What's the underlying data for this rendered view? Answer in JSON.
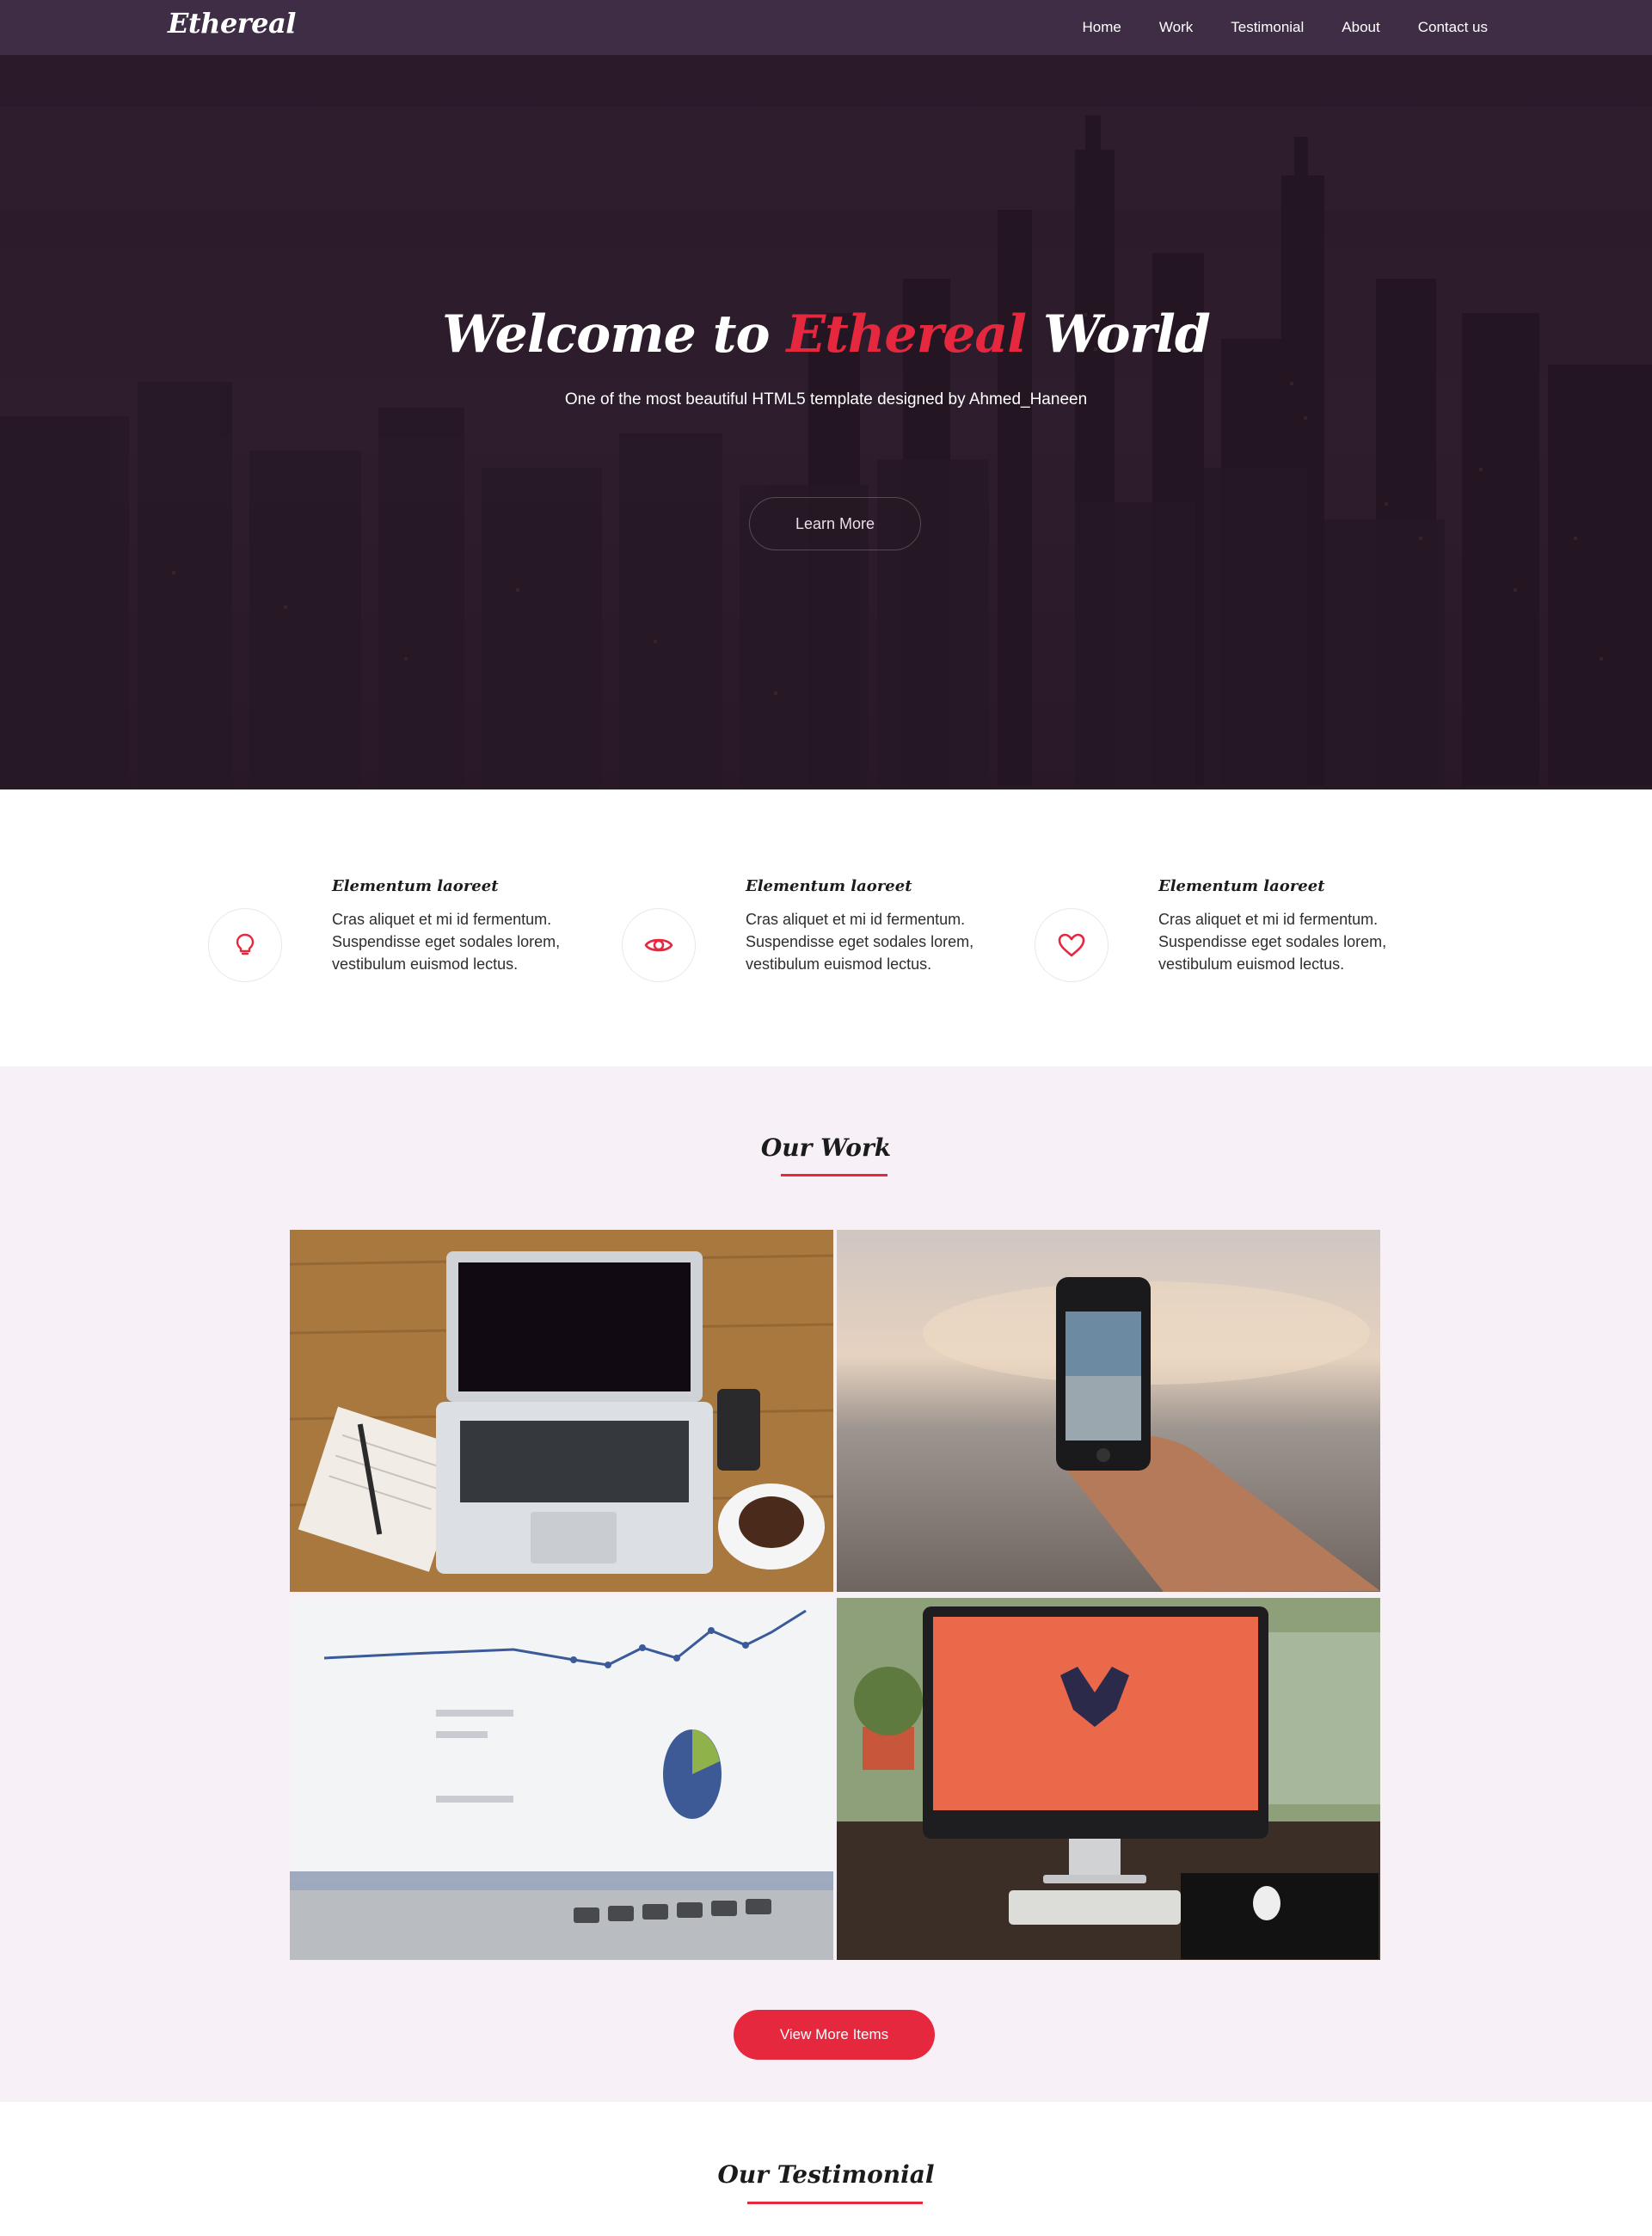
{
  "nav": {
    "brand": "Ethereal",
    "items": [
      {
        "label": "Home"
      },
      {
        "label": "Work"
      },
      {
        "label": "Testimonial"
      },
      {
        "label": "About"
      },
      {
        "label": "Contact us"
      }
    ]
  },
  "hero": {
    "title_pre": "Welcome to ",
    "title_accent": "Ethereal",
    "title_post": " World",
    "subtitle": "One of the most beautiful HTML5 template designed by Ahmed_Haneen",
    "button": "Learn More"
  },
  "features": [
    {
      "icon": "lightbulb-icon",
      "title": "Elementum laoreet",
      "text": "Cras aliquet et mi id fermentum. Suspendisse eget sodales lorem, vestibulum euismod lectus."
    },
    {
      "icon": "eye-icon",
      "title": "Elementum laoreet",
      "text": "Cras aliquet et mi id fermentum. Suspendisse eget sodales lorem, vestibulum euismod lectus."
    },
    {
      "icon": "heart-icon",
      "title": "Elementum laoreet",
      "text": "Cras aliquet et mi id fermentum. Suspendisse eget sodales lorem, vestibulum euismod lectus."
    }
  ],
  "work": {
    "title": "Our Work",
    "button": "View More Items"
  },
  "testimonial": {
    "title": "Our Testimonial"
  },
  "colors": {
    "accent": "#e6283f",
    "nav_bg": "#3e2d45",
    "work_bg": "#f8f0f7"
  }
}
